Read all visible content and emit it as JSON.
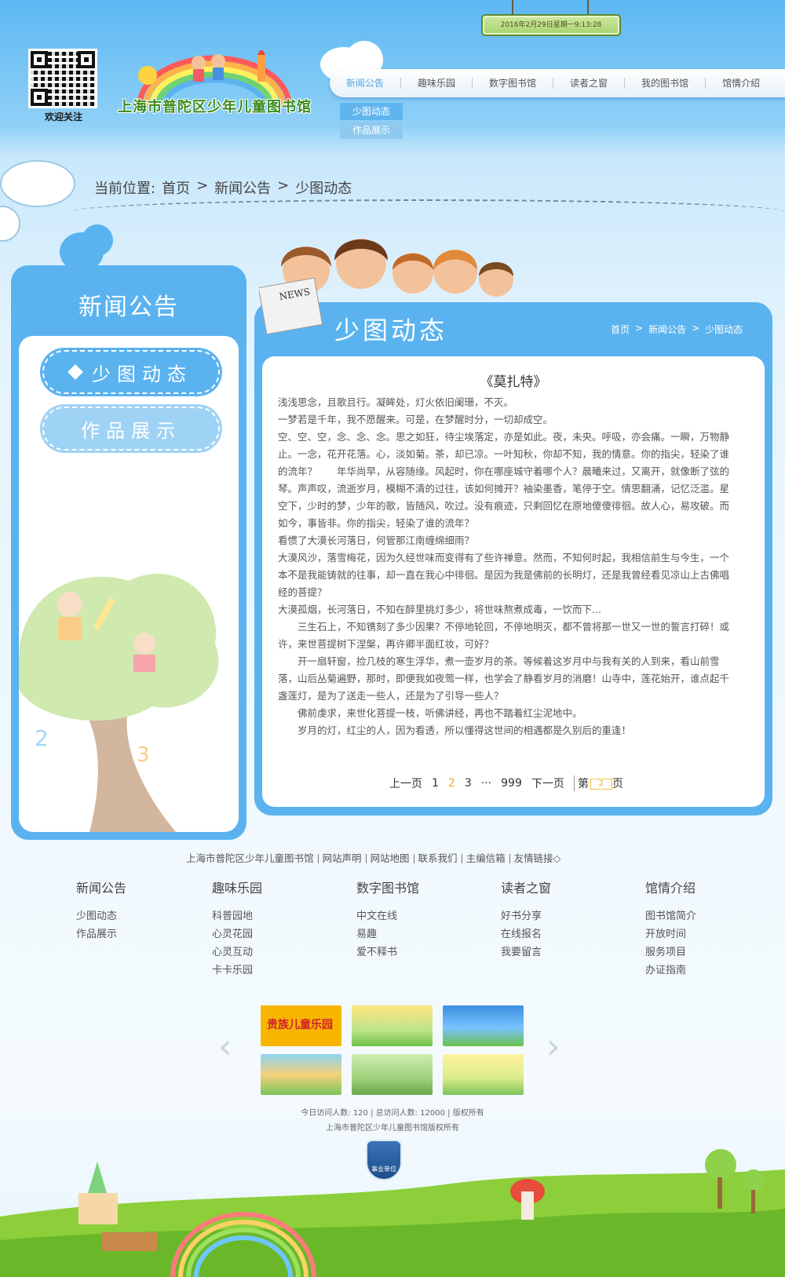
{
  "header": {
    "datetime": "2016年2月29日星期一9:13:28",
    "qr_caption": "欢迎关注",
    "logo_text": "上海市普陀区少年儿童图书馆"
  },
  "nav": {
    "items": [
      {
        "label": "新闻公告",
        "active": true
      },
      {
        "label": "趣味乐园",
        "active": false
      },
      {
        "label": "数字图书馆",
        "active": false
      },
      {
        "label": "读者之窗",
        "active": false
      },
      {
        "label": "我的图书馆",
        "active": false
      },
      {
        "label": "馆情介绍",
        "active": false
      }
    ],
    "sub_items": [
      {
        "label": "少图动态",
        "active": true
      },
      {
        "label": "作品展示",
        "active": false
      }
    ]
  },
  "breadcrumb": {
    "prefix": "当前位置:",
    "items": [
      "首页",
      ">",
      "新闻公告",
      ">",
      "少图动态"
    ]
  },
  "sidebar": {
    "title": "新闻公告",
    "buttons": [
      "少图动态",
      "作品展示"
    ]
  },
  "main": {
    "title": "少图动态",
    "crumb": [
      "首页",
      ">",
      "新闻公告",
      ">",
      "少图动态"
    ],
    "article_title": "《莫扎特》",
    "paragraphs": [
      {
        "text": "浅浅思念，且歌且行。凝眸处，灯火依旧阑珊，不灭。",
        "indent": false
      },
      {
        "text": "一梦若是千年，我不愿醒来。可是，在梦醒时分，一切却成空。",
        "indent": false
      },
      {
        "text": "空、空、空，念、念、念。思之如狂，待尘埃落定，亦是如此。夜，未央。呼吸，亦会痛。一瞬，万物静止。一念，花开花落。心，淡如菊。茶，却已凉。一叶知秋，你却不知，我的情意。你的指尖，轻染了谁的流年？　　年华尚早，从容随缘。风起时，你在哪座城守着哪个人？晨曦来过，又离开，就像断了弦的琴。声声叹，流逝岁月，模糊不清的过往，该如何摊开？袖染墨香，笔停于空。情思翻涌，记忆泛滥。星空下，少时的梦，少年的歌，皆随风，吹过。没有痕迹，只剩回忆在原地傻傻徘徊。故人心，易攻破。而如今，事皆非。你的指尖，轻染了谁的流年？",
        "indent": false
      },
      {
        "text": "看惯了大漠长河落日，何管那江南缠绵细雨？",
        "indent": false
      },
      {
        "text": "大漠风沙，落雪梅花，因为久经世味而变得有了些许禅意。然而，不知何时起，我相信前生与今生，一个本不是我能铸就的往事，却一直在我心中徘徊。是因为我是佛前的长明灯，还是我曾经看见凉山上古佛唱经的菩提？",
        "indent": false
      },
      {
        "text": "大漠孤烟，长河落日，不知在醉里挑灯多少，将世味熬煮成毒，一饮而下...",
        "indent": false
      },
      {
        "text": "三生石上，不知镌刻了多少因果？不停地轮回，不停地明灭，都不曾将那一世又一世的誓言打碎！或许，来世菩提树下涅槃，再许卿半面红妆，可好？",
        "indent": true
      },
      {
        "text": "开一扇轩窗，捡几枝的寒生浮华，煮一壶岁月的茶。等候着这岁月中与我有关的人到来，看山前雪落，山后丛菊遍野，那时，即便我如夜莺一样，也学会了静看岁月的消磨！山寺中，莲花始开，谁点起千盏莲灯，是为了送走一些人，还是为了引导一些人？",
        "indent": true
      },
      {
        "text": "佛前虔求，来世化菩提一枝，听佛讲经，再也不踏着红尘泥地中。",
        "indent": true
      },
      {
        "text": "岁月的灯，红尘的人，因为看透，所以懂得这世间的相遇都是久别后的重逢！",
        "indent": true
      }
    ],
    "pager": {
      "prev": "上一页",
      "pages": [
        "1",
        "2",
        "3",
        "···",
        "999"
      ],
      "current": "2",
      "next": "下一页",
      "goto_prefix": "第",
      "goto_value": "2",
      "goto_suffix": "页"
    }
  },
  "footer": {
    "links": [
      "上海市普陀区少年儿童图书馆",
      "网站声明",
      "网站地图",
      "联系我们",
      "主编信箱",
      "友情链接◇"
    ],
    "columns": [
      {
        "title": "新闻公告",
        "items": [
          "少图动态",
          "作品展示"
        ]
      },
      {
        "title": "趣味乐园",
        "items": [
          "科普园地",
          "心灵花园",
          "心灵互动",
          "卡卡乐园"
        ]
      },
      {
        "title": "数字图书馆",
        "items": [
          "中文在线",
          "易趣",
          "爱不释书"
        ]
      },
      {
        "title": "读者之窗",
        "items": [
          "好书分享",
          "在线报名",
          "我要留言"
        ]
      },
      {
        "title": "馆情介绍",
        "items": [
          "图书馆简介",
          "开放时间",
          "服务项目",
          "办证指南"
        ]
      }
    ],
    "stats_line": "今日访问人数:  120 | 总访问人数:  12000 | 版权所有",
    "copyright": "上海市普陀区少年儿童图书馆版权所有",
    "badge": "事业单位",
    "thumb_text_1": "贵族儿童乐园"
  },
  "colors": {
    "primary": "#5ab3ef",
    "accent": "#f5a623",
    "nav_active": "#4aa6e8"
  }
}
